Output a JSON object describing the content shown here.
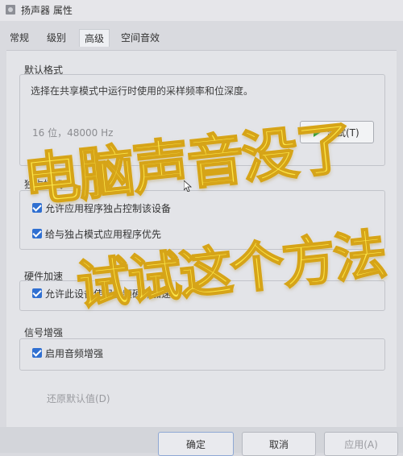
{
  "window": {
    "title": "扬声器 属性"
  },
  "tabs": [
    {
      "label": "常规"
    },
    {
      "label": "级别"
    },
    {
      "label": "高级"
    },
    {
      "label": "空间音效"
    }
  ],
  "default_format": {
    "heading": "默认格式",
    "description": "选择在共享模式中运行时使用的采样频率和位深度。",
    "combo_value": "16 位，48000 Hz",
    "test_button": "测试(T)"
  },
  "exclusive_mode": {
    "heading": "独占模式",
    "options": [
      {
        "label": "允许应用程序独占控制该设备"
      },
      {
        "label": "给与独占模式应用程序优先"
      }
    ]
  },
  "hardware_accel": {
    "heading": "硬件加速",
    "options": [
      {
        "label": "允许此设备使用音频硬件加速"
      }
    ]
  },
  "signal_enhancement": {
    "heading": "信号增强",
    "options": [
      {
        "label": "启用音频增强"
      }
    ]
  },
  "restore_defaults": "还原默认值(D)",
  "footer": {
    "ok": "确定",
    "cancel": "取消",
    "apply": "应用(A)"
  },
  "overlay": {
    "line1": "电脑声音没了",
    "line2": "试试这个方法"
  },
  "colors": {
    "accent": "#2f6fd1",
    "overlay_fill": "#fde84a",
    "overlay_stroke": "#d6a418",
    "play": "#23a33a"
  }
}
